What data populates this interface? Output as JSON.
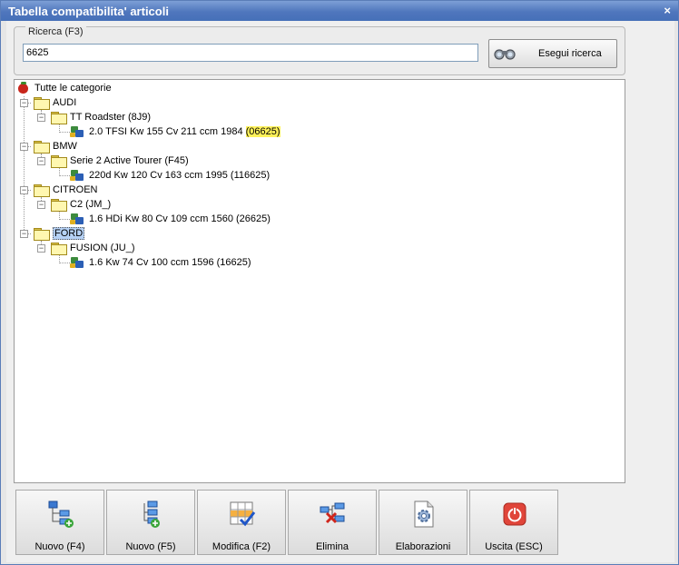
{
  "window": {
    "title": "Tabella compatibilita' articoli",
    "close": "×"
  },
  "search": {
    "legend": "Ricerca (F3)",
    "value": "6625",
    "button_label": "Esegui ricerca"
  },
  "tree": {
    "root": "Tutte le categorie",
    "brands": [
      {
        "name": "AUDI",
        "model": "TT Roadster (8J9)",
        "item_text": "2.0 TFSI Kw 155 Cv 211 ccm 1984 ",
        "item_code": "(06625)"
      },
      {
        "name": "BMW",
        "model": "Serie 2 Active Tourer (F45)",
        "item_text": "220d Kw 120 Cv 163 ccm 1995 (116625)"
      },
      {
        "name": "CITROEN",
        "model": "C2 (JM_)",
        "item_text": "1.6 HDi Kw 80 Cv 109 ccm 1560 (26625)"
      },
      {
        "name": "FORD",
        "model": "FUSION (JU_)",
        "item_text": "1.6 Kw 74 Cv 100 ccm 1596 (16625)"
      }
    ]
  },
  "toolbar": {
    "new_f4": "Nuovo (F4)",
    "new_f5": "Nuovo (F5)",
    "edit": "Modifica (F2)",
    "delete": "Elimina",
    "process": "Elaborazioni",
    "exit": "Uscita (ESC)"
  },
  "colors": {
    "titlebar": "#4f76bd",
    "highlight": "#fff25a",
    "selection": "#b5d1f5"
  }
}
